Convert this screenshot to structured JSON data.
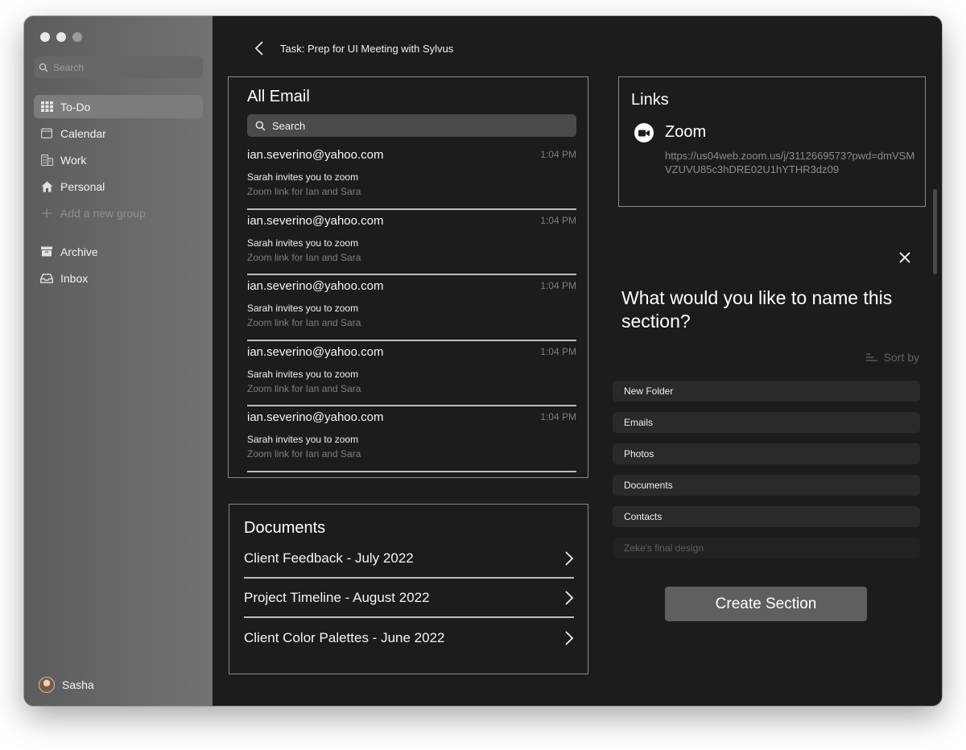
{
  "sidebar": {
    "search_placeholder": "Search",
    "items": [
      {
        "label": "To-Do",
        "icon": "grid-icon",
        "active": true
      },
      {
        "label": "Calendar",
        "icon": "calendar-icon"
      },
      {
        "label": "Work",
        "icon": "building-icon"
      },
      {
        "label": "Personal",
        "icon": "house-icon"
      },
      {
        "label": "Add a new group",
        "icon": "plus-icon"
      }
    ],
    "secondary_items": [
      {
        "label": "Archive",
        "icon": "archive-icon"
      },
      {
        "label": "Inbox",
        "icon": "inbox-icon"
      }
    ],
    "user": {
      "name": "Sasha"
    }
  },
  "header": {
    "title": "Task: Prep for UI Meeting with Sylvus"
  },
  "emails": {
    "title": "All Email",
    "search_placeholder": "Search",
    "items": [
      {
        "from": "ian.severino@yahoo.com",
        "time": "1:04 PM",
        "subject": "Sarah invites you to zoom",
        "preview": "Zoom link for Ian and Sara"
      },
      {
        "from": "ian.severino@yahoo.com",
        "time": "1:04 PM",
        "subject": "Sarah invites you to zoom",
        "preview": "Zoom link for Ian and Sara"
      },
      {
        "from": "ian.severino@yahoo.com",
        "time": "1:04 PM",
        "subject": "Sarah invites you to zoom",
        "preview": "Zoom link for Ian and Sara"
      },
      {
        "from": "ian.severino@yahoo.com",
        "time": "1:04 PM",
        "subject": "Sarah invites you to zoom",
        "preview": "Zoom link for Ian and Sara"
      },
      {
        "from": "ian.severino@yahoo.com",
        "time": "1:04 PM",
        "subject": "Sarah invites you to zoom",
        "preview": "Zoom link for Ian and Sara"
      }
    ]
  },
  "documents": {
    "title": "Documents",
    "items": [
      {
        "name": "Client Feedback - July 2022"
      },
      {
        "name": "Project Timeline - August 2022"
      },
      {
        "name": "Client Color Palettes - June 2022"
      }
    ]
  },
  "links": {
    "title": "Links",
    "zoom": {
      "name": "Zoom",
      "url": "https://us04web.zoom.us/j/3112669573?pwd=dmVSMVZUVU85c3hDRE02U1hYTHR3dz09"
    }
  },
  "dialog": {
    "question": "What would you like to name this section?",
    "sort_label": "Sort by",
    "options": [
      "New Folder",
      "Emails",
      "Photos",
      "Documents",
      "Contacts"
    ],
    "faded_option": "Zeke's final design",
    "create_label": "Create Section"
  }
}
